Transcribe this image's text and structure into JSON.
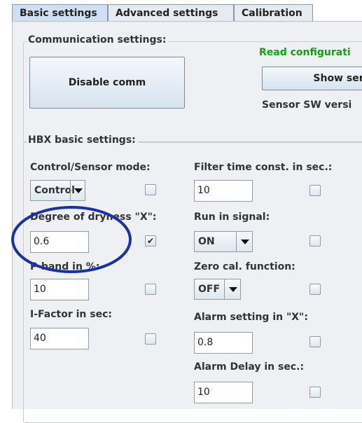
{
  "tabs": [
    {
      "label": "Basic settings"
    },
    {
      "label": "Advanced settings"
    },
    {
      "label": "Calibration"
    }
  ],
  "communication": {
    "legend": "Communication settings:",
    "disable_button": "Disable comm",
    "read_config": "Read configurati",
    "show_sensor_button": "Show sens",
    "sensor_sw_version": "Sensor SW versi"
  },
  "hbx": {
    "legend": "HBX basic settings:",
    "control_mode_label": "Control/Sensor mode:",
    "control_mode_value": "Control",
    "filter_label": "Filter time const. in sec.:",
    "filter_value": "10",
    "dryness_label": "Degree of dryness \"X\":",
    "dryness_value": "0.6",
    "run_in_label": "Run in signal:",
    "run_in_value": "ON",
    "pband_label": "P-band in %:",
    "pband_value": "10",
    "zero_cal_label": "Zero cal. function:",
    "zero_cal_value": "OFF",
    "ifactor_label": "I-Factor in sec:",
    "ifactor_value": "40",
    "alarm_label": "Alarm setting in \"X\":",
    "alarm_value": "0.8",
    "alarm_delay_label": "Alarm Delay in sec.:",
    "alarm_delay_value": "10"
  },
  "checkboxes": {
    "control_mode": false,
    "filter": false,
    "dryness": true,
    "run_in": false,
    "pband": false,
    "zero_cal": false,
    "ifactor": false,
    "alarm": false,
    "alarm_delay": false
  },
  "colors": {
    "annotation_circle": "#1a2fa8",
    "read_config_text": "#11a311",
    "active_tab": "#cfe0f4"
  },
  "icons": {
    "combo_arrow": "chevron-down-icon",
    "checkmark": "checkmark-icon"
  }
}
